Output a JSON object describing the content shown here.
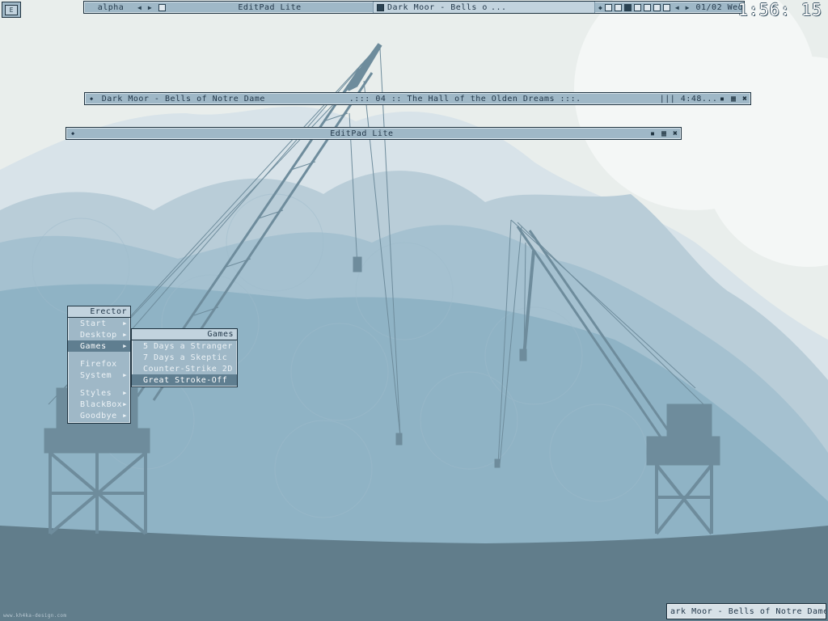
{
  "toolbar": {
    "workspace_name": "alpha",
    "app_title": "EditPad Lite",
    "active_task": "Dark Moor - Bells of Notre Dame",
    "active_task_more": "...",
    "date": "01/02 Wed"
  },
  "clock": {
    "time": "1:56: 15"
  },
  "menu_toggle": {
    "label": "E"
  },
  "windows": {
    "player": {
      "title": "Dark Moor - Bells of Notre Dame",
      "track": ".::: 04 :: The Hall of the Olden Dreams :::.",
      "time": "||| 4:48..."
    },
    "editpad": {
      "title": "EditPad Lite"
    }
  },
  "root_menu": {
    "title": "Erector",
    "items": [
      {
        "label": "Start",
        "submenu": true
      },
      {
        "label": "Desktop",
        "submenu": true
      },
      {
        "label": "Games",
        "submenu": true,
        "selected": true
      },
      {
        "label": "Firefox",
        "submenu": false
      },
      {
        "label": "System",
        "submenu": true
      },
      {
        "label": "Styles",
        "submenu": true
      },
      {
        "label": "BlackBox",
        "submenu": true
      },
      {
        "label": "Goodbye",
        "submenu": true
      }
    ]
  },
  "games_menu": {
    "title": "Games",
    "items": [
      {
        "label": "5 Days a Stranger"
      },
      {
        "label": "7 Days a Skeptic"
      },
      {
        "label": "Counter-Strike 2D"
      },
      {
        "label": "Great Stroke-Off",
        "selected": true
      }
    ]
  },
  "slit": {
    "text": "ark Moor - Bells of Notre Dame"
  },
  "credit": {
    "text": "www.kh4ka-design.com"
  },
  "colors": {
    "sky_light": "#e9eeec",
    "cloud_mid": "#c6d6df",
    "water_mid": "#8fb3c5",
    "ground": "#617d8b",
    "crane": "#6e8c9c",
    "bar": "#9fb8c7",
    "border": "#1f3340"
  }
}
